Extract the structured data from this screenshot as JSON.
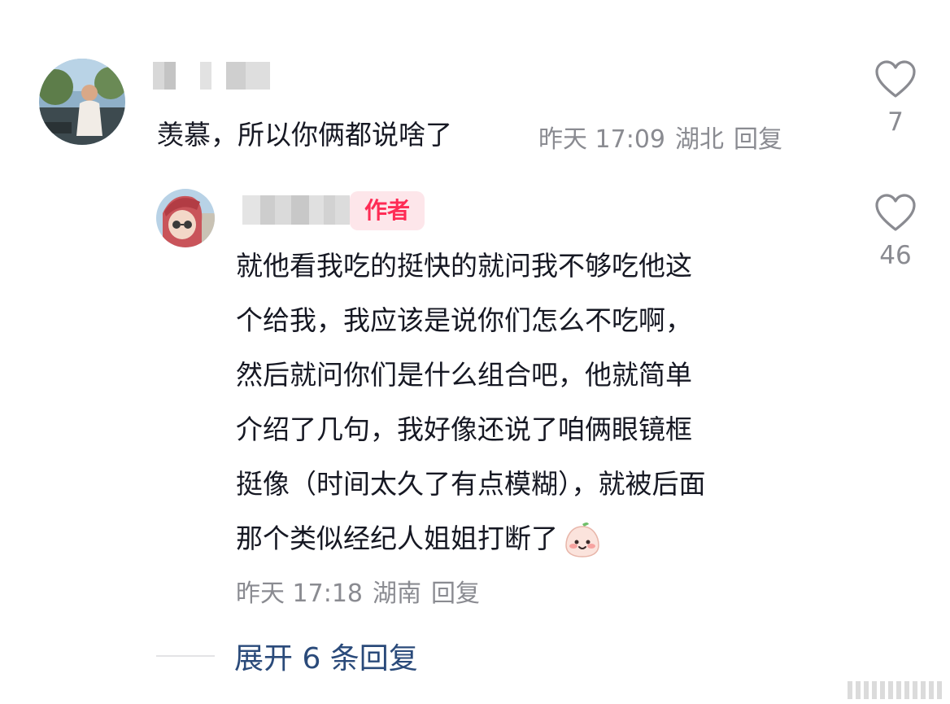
{
  "comment": {
    "text": "羡慕，所以你俩都说啥了",
    "time": "昨天 17:09",
    "location": "湖北",
    "reply_label": "回复",
    "likes": "7"
  },
  "reply": {
    "badge": "作者",
    "lines": [
      "就他看我吃的挺快的就问我不够吃他这",
      "个给我，我应该是说你们怎么不吃啊，",
      "然后就问你们是什么组合吧，他就简单",
      "介绍了几句，我好像还说了咱俩眼镜框",
      "挺像（时间太久了有点模糊），就被后面",
      "那个类似经纪人姐姐打断了"
    ],
    "time": "昨天 17:18",
    "location": "湖南",
    "reply_label": "回复",
    "likes": "46",
    "emoji_icon": "blushing-face-emoji"
  },
  "expand": {
    "label": "展开 6 条回复"
  },
  "colors": {
    "text": "#161823",
    "meta": "#8a8b91",
    "badge_bg": "#fde6ea",
    "badge_fg": "#fe2c55",
    "expand": "#2a4a7a"
  }
}
